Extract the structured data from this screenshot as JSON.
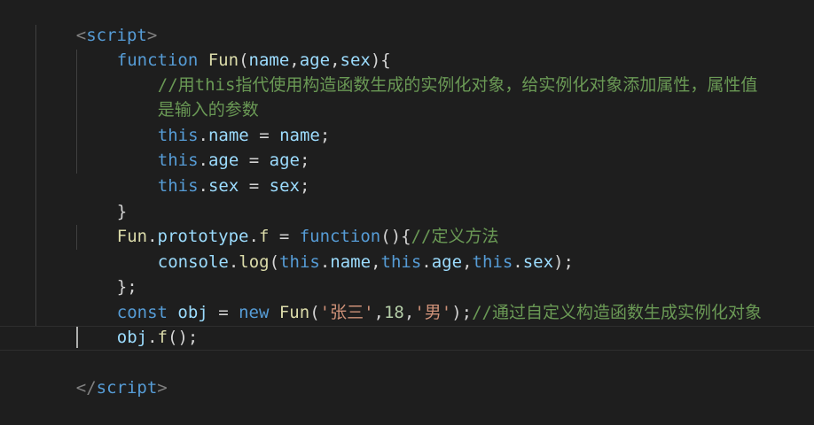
{
  "editor": {
    "colors": {
      "background": "#1e1e1e",
      "keyword": "#569cd6",
      "function": "#dcdcaa",
      "variable": "#9cdcfe",
      "comment": "#6a9955",
      "string": "#ce9178",
      "number": "#b5cea8"
    },
    "lines": {
      "l1": [
        "<",
        "script",
        ">"
      ],
      "l2": [
        "function",
        " ",
        "Fun",
        "(",
        "name",
        ",",
        "age",
        ",",
        "sex",
        "){"
      ],
      "l3": [
        "//用this指代使用构造函数生成的实例化对象，给实例化对象添加属性，属性值"
      ],
      "l4": [
        "是输入的参数"
      ],
      "l5": [
        "this",
        ".",
        "name",
        " = ",
        "name",
        ";"
      ],
      "l6": [
        "this",
        ".",
        "age",
        " = ",
        "age",
        ";"
      ],
      "l7": [
        "this",
        ".",
        "sex",
        " = ",
        "sex",
        ";"
      ],
      "l8": [
        "}"
      ],
      "l9": [
        "Fun",
        ".",
        "prototype",
        ".",
        "f",
        " = ",
        "function",
        "(){",
        "//定义方法"
      ],
      "l10": [
        "console",
        ".",
        "log",
        "(",
        "this",
        ".",
        "name",
        ",",
        "this",
        ".",
        "age",
        ",",
        "this",
        ".",
        "sex",
        ");"
      ],
      "l11": [
        "};"
      ],
      "l12": [
        "const",
        " ",
        "obj",
        " = ",
        "new",
        " ",
        "Fun",
        "(",
        "'张三'",
        ",",
        "18",
        ",",
        "'男'",
        ");",
        "//通过自定义构造函数生成实例化对象"
      ],
      "l13": [
        "obj",
        ".",
        "f",
        "();"
      ],
      "l15": [
        "</",
        "script",
        ">"
      ]
    }
  }
}
